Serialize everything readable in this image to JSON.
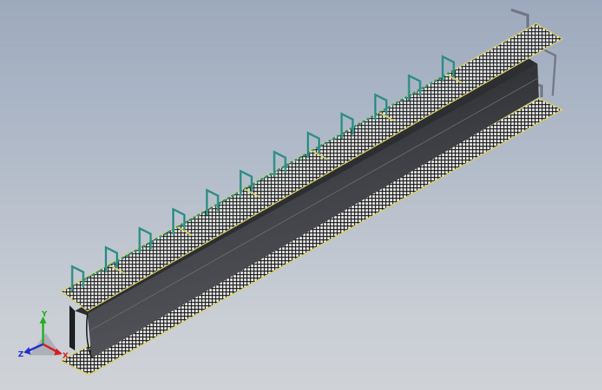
{
  "viewport": {
    "background_top": "#9daabd",
    "background_bottom": "#cfd2d6"
  },
  "model": {
    "trough_color": "#3a3c40",
    "grating_color": "#101010",
    "grating_edge_color": "#d8d060",
    "railing_color": "#2f8f86",
    "support_count": 12
  },
  "triad": {
    "x_label": "X",
    "y_label": "Y",
    "z_label": "Z",
    "x_color": "#d42020",
    "y_color": "#22b022",
    "z_color": "#2030d0"
  }
}
